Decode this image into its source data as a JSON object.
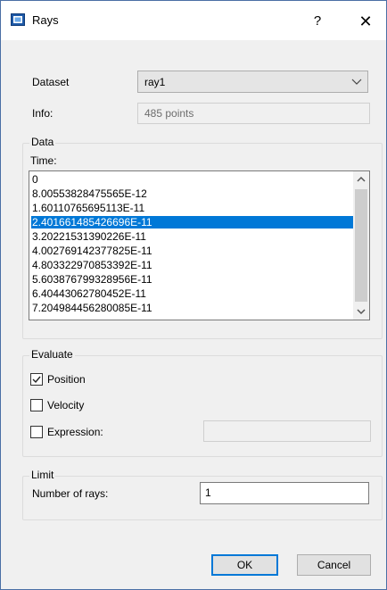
{
  "window": {
    "title": "Rays",
    "help_glyph": "?",
    "close_glyph": "✕"
  },
  "dataset": {
    "label": "Dataset",
    "value": "ray1"
  },
  "info": {
    "label": "Info:",
    "value": "485 points"
  },
  "data_group": {
    "title": "Data",
    "time_label": "Time:",
    "items": [
      "0",
      "8.00553828475565E-12",
      "1.60110765695113E-11",
      "2.401661485426696E-11",
      "3.20221531390226E-11",
      "4.002769142377825E-11",
      "4.803322970853392E-11",
      "5.603876799328956E-11",
      "6.40443062780452E-11",
      "7.204984456280085E-11"
    ],
    "selected_index": 3
  },
  "evaluate": {
    "title": "Evaluate",
    "position": {
      "label": "Position",
      "checked": true
    },
    "velocity": {
      "label": "Velocity",
      "checked": false
    },
    "expression": {
      "label": "Expression:",
      "checked": false,
      "value": ""
    }
  },
  "limit": {
    "title": "Limit",
    "rays_label": "Number of rays:",
    "rays_value": "1"
  },
  "buttons": {
    "ok": "OK",
    "cancel": "Cancel"
  },
  "colors": {
    "selection": "#0078d7",
    "window_bg": "#f0f0f0",
    "icon_blue": "#1e5aa8"
  }
}
